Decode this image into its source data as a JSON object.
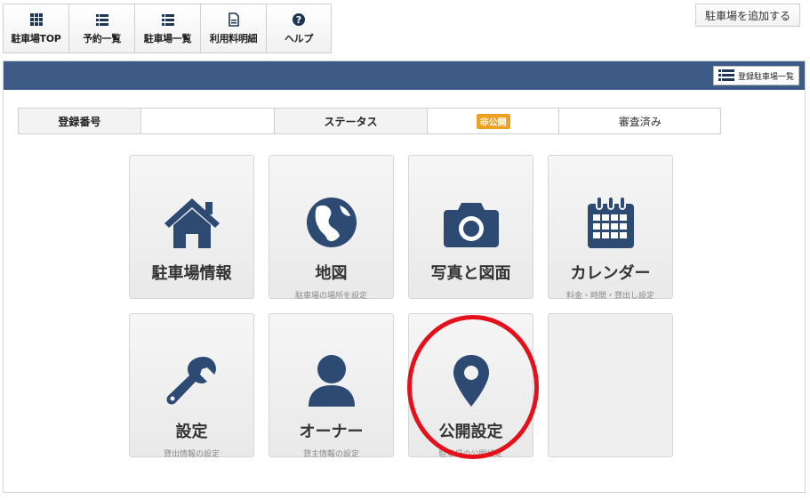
{
  "topnav": {
    "items": [
      {
        "label": "駐車場TOP",
        "icon": "grid-icon"
      },
      {
        "label": "予約一覧",
        "icon": "list-icon"
      },
      {
        "label": "駐車場一覧",
        "icon": "list-icon"
      },
      {
        "label": "利用料明細",
        "icon": "document-icon"
      },
      {
        "label": "ヘルプ",
        "icon": "help-icon"
      }
    ]
  },
  "add_parking_label": "駐車場を追加する",
  "header": {
    "list_button_label": "登録駐車場一覧"
  },
  "status_row": {
    "reg_no_label": "登録番号",
    "reg_no_value": "",
    "status_label": "ステータス",
    "status_badge": "非公開",
    "review_status": "審査済み"
  },
  "tiles": [
    {
      "title": "駐車場情報",
      "subtitle": "",
      "icon": "home-icon"
    },
    {
      "title": "地図",
      "subtitle": "駐車場の場所を設定",
      "icon": "globe-icon"
    },
    {
      "title": "写真と図面",
      "subtitle": "",
      "icon": "camera-icon"
    },
    {
      "title": "カレンダー",
      "subtitle": "料金・時間・貸出し設定",
      "icon": "calendar-icon"
    },
    {
      "title": "設定",
      "subtitle": "貸出情報の設定",
      "icon": "wrench-icon"
    },
    {
      "title": "オーナー",
      "subtitle": "貸主情報の設定",
      "icon": "user-icon"
    },
    {
      "title": "公開設定",
      "subtitle": "駐車場の公開設定",
      "icon": "map-pin-icon"
    }
  ],
  "colors": {
    "header": "#3d5b86",
    "icon": "#2d4a72",
    "badge": "#f0a021",
    "annotation": "#e5101a"
  }
}
